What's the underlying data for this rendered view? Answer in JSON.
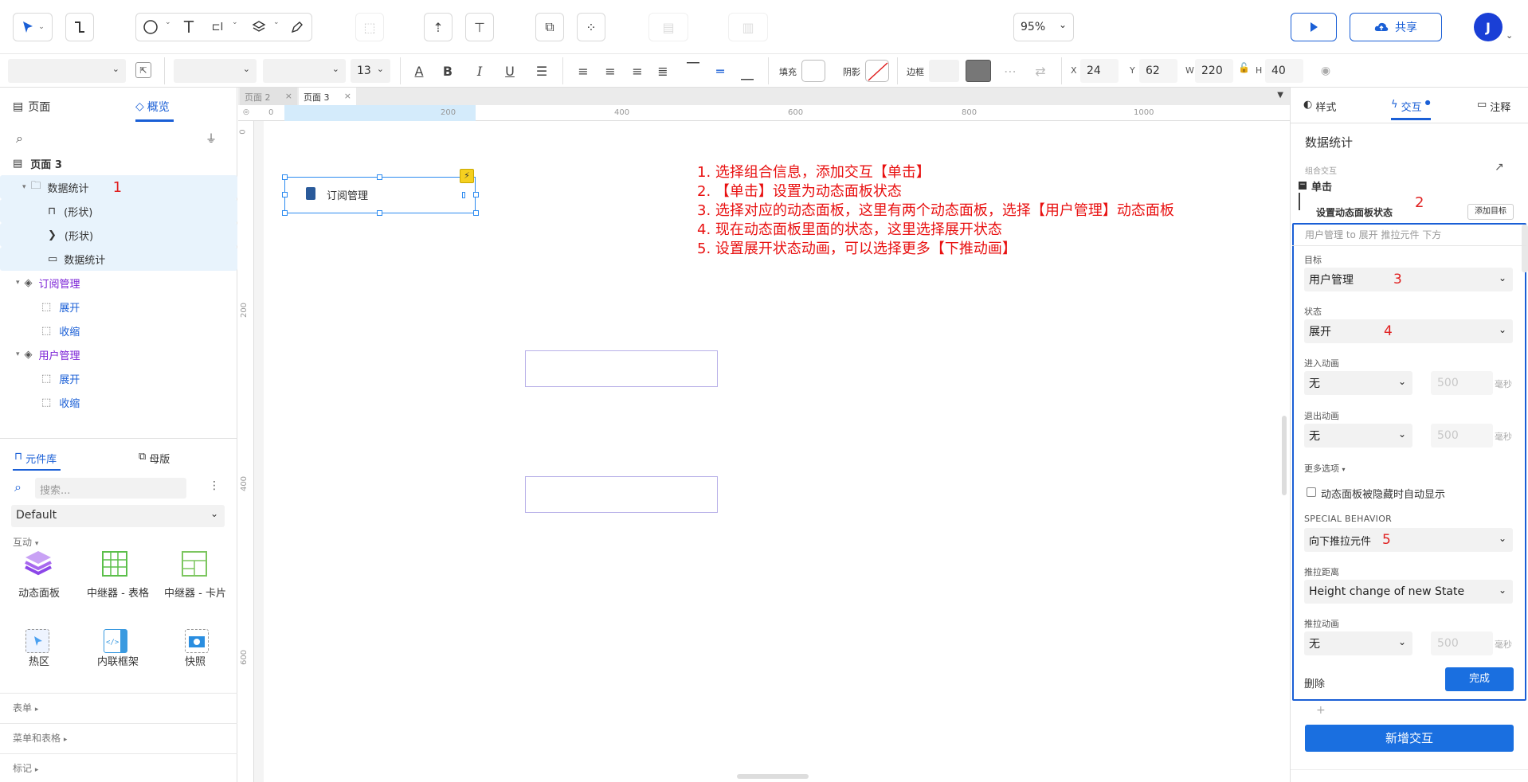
{
  "toolbar": {
    "zoom": "95%",
    "share_label": "共享",
    "avatar_letter": "J"
  },
  "format_bar": {
    "font_size": "13",
    "fill_label": "填充",
    "shadow_label": "阴影",
    "border_label": "边框",
    "x_label": "X",
    "x_value": "24",
    "y_label": "Y",
    "y_value": "62",
    "w_label": "W",
    "w_value": "220",
    "h_label": "H",
    "h_value": "40"
  },
  "left_panel": {
    "tab_pages": "页面",
    "tab_overview": "概览",
    "page_title": "页面 3",
    "tree": [
      {
        "label": "数据统计",
        "marker": "1"
      },
      {
        "label": "(形状)"
      },
      {
        "label": "(形状)"
      },
      {
        "label": "数据统计"
      },
      {
        "label": "订阅管理"
      },
      {
        "label": "展开"
      },
      {
        "label": "收缩"
      },
      {
        "label": "用户管理"
      },
      {
        "label": "展开"
      },
      {
        "label": "收缩"
      }
    ],
    "lib_tab": "元件库",
    "master_tab": "母版",
    "search_placeholder": "搜索...",
    "library_select": "Default",
    "section_interactive": "互动",
    "components": [
      "动态面板",
      "中继器 - 表格",
      "中继器 - 卡片",
      "热区",
      "内联框架",
      "快照"
    ],
    "section_forms": "表单",
    "section_menus": "菜单和表格",
    "section_marks": "标记"
  },
  "canvas": {
    "tabs": [
      "页面 2",
      "页面 3"
    ],
    "ruler_h": [
      "0",
      "200",
      "400",
      "600",
      "800",
      "1000"
    ],
    "ruler_v": [
      "0",
      "200",
      "400",
      "600"
    ],
    "widget_label": "订阅管理",
    "notes": [
      "1. 选择组合信息，添加交互【单击】",
      "2. 【单击】设置为动态面板状态",
      "3. 选择对应的动态面板，这里有两个动态面板，选择【用户管理】动态面板",
      "4. 现在动态面板里面的状态，这里选择展开状态",
      "5. 设置展开状态动画，可以选择更多【下推动画】"
    ]
  },
  "right_panel": {
    "tab_style": "样式",
    "tab_interact": "交互",
    "tab_notes": "注释",
    "element_name": "数据统计",
    "group_interaction": "组合交互",
    "event": "单击",
    "action": "设置动态面板状态",
    "marker2": "2",
    "add_target": "添加目标",
    "summary": "用户管理 to 展开 推拉元件 下方",
    "target_label": "目标",
    "target_value": "用户管理",
    "marker3": "3",
    "state_label": "状态",
    "state_value": "展开",
    "marker4": "4",
    "enter_anim_label": "进入动画",
    "enter_anim": "无",
    "enter_ms": "500",
    "exit_anim_label": "退出动画",
    "exit_anim": "无",
    "exit_ms": "500",
    "ms_unit": "毫秒",
    "more_options": "更多选项",
    "auto_show": "动态面板被隐藏时自动显示",
    "special_behavior": "SPECIAL BEHAVIOR",
    "push_value": "向下推拉元件",
    "marker5": "5",
    "push_distance_label": "推拉距离",
    "push_distance": "Height change of new State",
    "push_anim_label": "推拉动画",
    "push_anim": "无",
    "push_ms": "500",
    "delete": "删除",
    "done": "完成",
    "new_interaction": "新增交互"
  },
  "colors": {
    "accent": "#1a5fd6",
    "annotation": "#e81010",
    "selection": "#2d8bf0"
  }
}
